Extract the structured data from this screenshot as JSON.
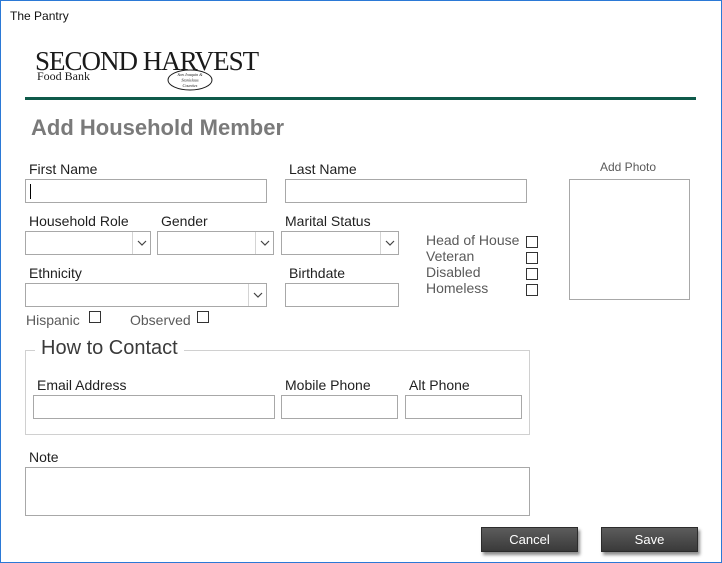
{
  "window": {
    "title": "The Pantry"
  },
  "logo": {
    "line1": "SECOND HARVEST",
    "line2": "Food Bank",
    "seal_lines": [
      "San Joaquin &",
      "Stanislaus",
      "Counties"
    ]
  },
  "page": {
    "heading": "Add Household Member"
  },
  "form": {
    "first_name": {
      "label": "First Name",
      "value": ""
    },
    "last_name": {
      "label": "Last Name",
      "value": ""
    },
    "household_role": {
      "label": "Household Role",
      "selected": ""
    },
    "gender": {
      "label": "Gender",
      "selected": ""
    },
    "marital_status": {
      "label": "Marital Status",
      "selected": ""
    },
    "ethnicity": {
      "label": "Ethnicity",
      "selected": ""
    },
    "birthdate": {
      "label": "Birthdate",
      "value": ""
    },
    "hispanic": {
      "label": "Hispanic",
      "checked": false
    },
    "observed": {
      "label": "Observed",
      "checked": false
    },
    "flags": [
      {
        "label": "Head of House",
        "checked": false
      },
      {
        "label": "Veteran",
        "checked": false
      },
      {
        "label": "Disabled",
        "checked": false
      },
      {
        "label": "Homeless",
        "checked": false
      }
    ],
    "photo": {
      "label": "Add Photo"
    }
  },
  "contact": {
    "title": "How to Contact",
    "email": {
      "label": "Email Address",
      "value": ""
    },
    "mobile": {
      "label": "Mobile Phone",
      "value": ""
    },
    "alt": {
      "label": "Alt Phone",
      "value": ""
    }
  },
  "note": {
    "label": "Note",
    "value": ""
  },
  "actions": {
    "cancel": "Cancel",
    "save": "Save"
  },
  "colors": {
    "brand_rule": "#0f5a4a",
    "window_border": "#2b79d6",
    "button": "#4a4a4a"
  }
}
